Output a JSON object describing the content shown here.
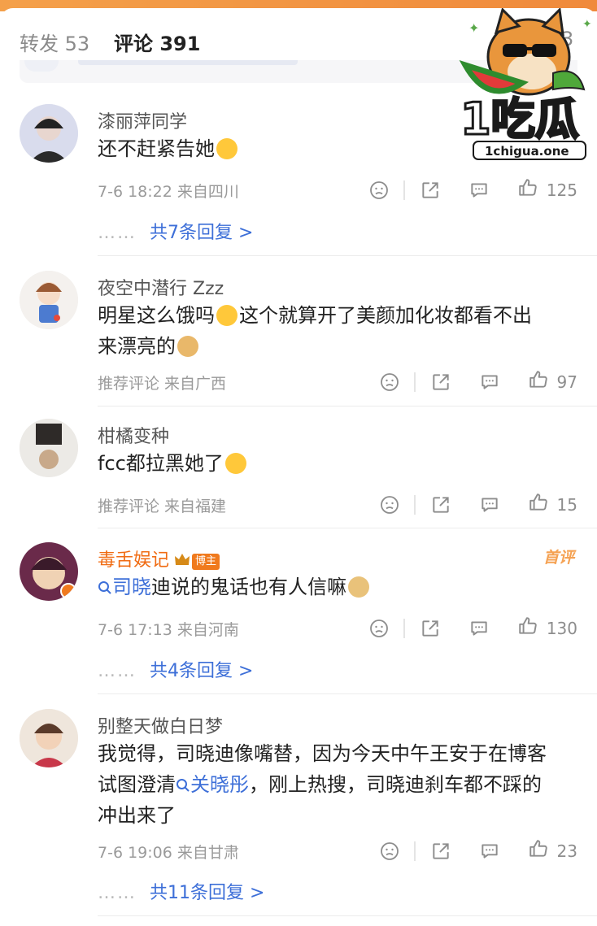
{
  "tabs": {
    "repost": "转发 53",
    "comments": "评论 391",
    "right_count": "3"
  },
  "logo": {
    "brand": "1吃瓜",
    "url": "1chigua.one"
  },
  "comments": [
    {
      "user": "漆丽萍同学",
      "text": "还不赶紧告她",
      "meta": "7-6 18:22  来自四川",
      "likes": "125",
      "replies": "共7条回复 >"
    },
    {
      "user": "夜空中潜行 Zzz",
      "text": "明星这么饿吗",
      "text2": "这个就算开了美颜加化妆都看不出",
      "text3": "来漂亮的",
      "meta": "推荐评论  来自广西",
      "likes": "97"
    },
    {
      "user": "柑橘变种",
      "text": "fcc都拉黑她了",
      "meta": "推荐评论  来自福建",
      "likes": "15"
    },
    {
      "user": "毒舌娱记",
      "badge": "博主",
      "top_tag": "首评",
      "link": "司晓",
      "text": "迪说的鬼话也有人信嘛",
      "meta": "7-6 17:13  来自河南",
      "likes": "130",
      "replies": "共4条回复 >"
    },
    {
      "user": "别整天做白日梦",
      "line1": "我觉得，司晓迪像嘴替，因为今天中午王安于在博客",
      "line2a": "试图澄清",
      "link": "关晓彤",
      "line2b": "，刚上热搜，司晓迪刹车都不踩的",
      "line3": "冲出来了",
      "meta": "7-6 19:06  来自甘肃",
      "likes": "23",
      "replies": "共11条回复 >"
    }
  ],
  "colors": {
    "accent": "#f08a3c",
    "link": "#3d6fd8",
    "hot_name": "#f06b12"
  },
  "icons": [
    "dislike-icon",
    "share-icon",
    "comment-icon",
    "like-icon"
  ],
  "reply_dots": "……"
}
